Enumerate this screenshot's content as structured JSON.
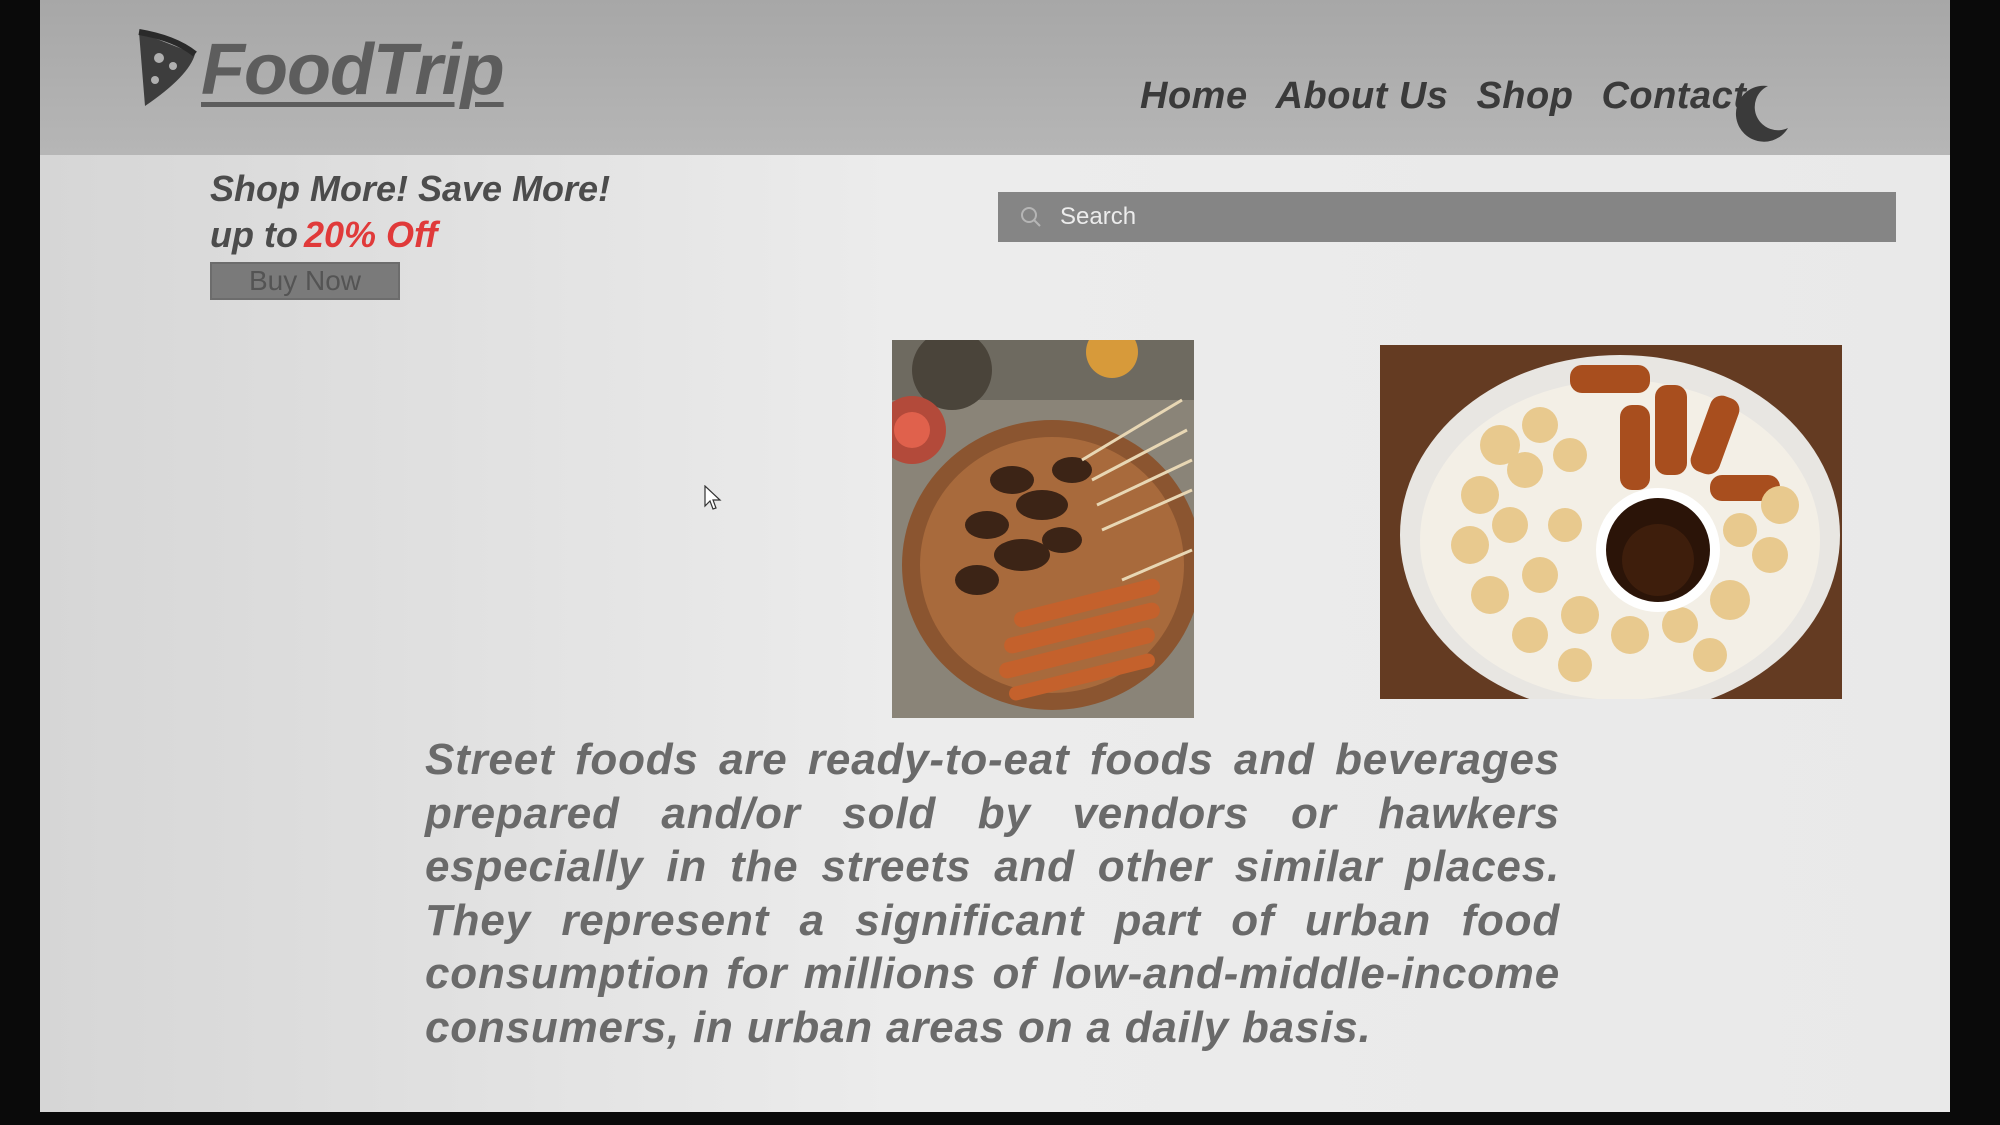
{
  "brand": {
    "name": "FoodTrip"
  },
  "nav": {
    "items": [
      "Home",
      "About Us",
      "Shop",
      "Contact"
    ],
    "theme_toggle_icon": "moon-icon"
  },
  "promo": {
    "line1": "Shop More! Save More!",
    "line2_prefix": "up to",
    "discount": "20% Off",
    "button_label": "Buy Now"
  },
  "search": {
    "placeholder": "Search",
    "icon": "search-icon"
  },
  "images": [
    {
      "name": "food-image-skewers",
      "subject": "grilled skewers on a plate"
    },
    {
      "name": "food-image-fishballs",
      "subject": "fish balls with dipping sauce"
    }
  ],
  "description": "Street foods are ready-to-eat foods and beverages prepared and/or sold by vendors or hawkers especially in the streets and other similar places. They represent a significant part of urban food consumption for millions of low-and-middle-income consumers, in urban areas on a daily basis.",
  "colors": {
    "header": "#b0b0b0",
    "accent": "#e03a3a",
    "text": "#4c4c4c",
    "search_bg": "#858585"
  }
}
